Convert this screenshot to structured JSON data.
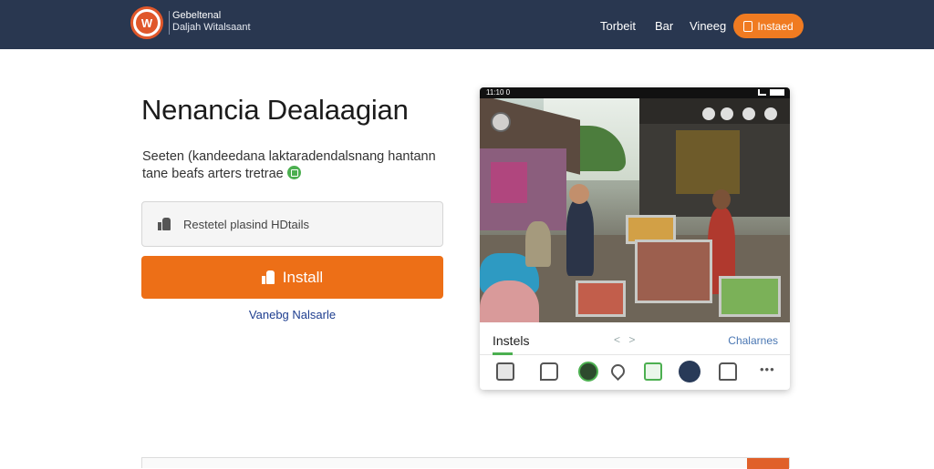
{
  "header": {
    "brand_line1": "Gebeltenal",
    "brand_line2": "Daljah Witalsaant",
    "nav": [
      "Torbeit",
      "Bar",
      "Vineeg"
    ],
    "install_button": "Instaed"
  },
  "hero": {
    "title": "Nenancia Dealaagian",
    "description": "Seeten (kandeedana laktaradendalsnang hantann tane beafs arters tretrae",
    "input_placeholder": "Restetel plasind HDtails",
    "install_button": "Install",
    "link": "Vanebg Nalsarle"
  },
  "phone": {
    "status_time": "11:10 0",
    "tab_active": "Instels",
    "tab_arrows": "< >",
    "tab_right": "Chalarnes",
    "dock_more": "•••"
  },
  "colors": {
    "header_bg": "#293750",
    "accent_orange": "#ed6f17",
    "accent_green": "#4caf50",
    "link_blue": "#1d3d8f"
  },
  "icons": {
    "logo": "emblem-logo",
    "install": "thumbs-up-icon",
    "input": "thumbs-up-icon",
    "desc_badge": "green-lock-icon"
  }
}
